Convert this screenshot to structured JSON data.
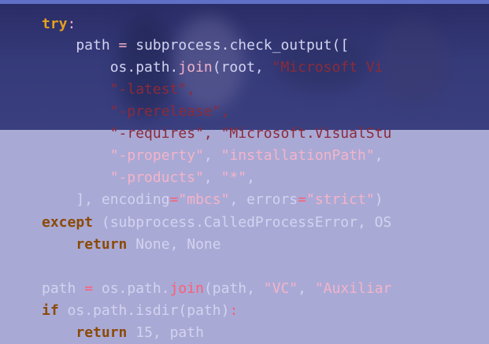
{
  "code": {
    "lines": [
      {
        "parts": [
          {
            "t": "try",
            "c": "kw"
          },
          {
            "t": ":",
            "c": "op"
          }
        ]
      },
      {
        "parts": [
          {
            "t": "    path ",
            "c": "plain"
          },
          {
            "t": "= ",
            "c": "op"
          },
          {
            "t": "subprocess.check_output([",
            "c": "plain"
          }
        ]
      },
      {
        "parts": [
          {
            "t": "        os.path.",
            "c": "plain"
          },
          {
            "t": "join",
            "c": "op"
          },
          {
            "t": "(root, ",
            "c": "plain"
          },
          {
            "t": "\"Microsoft Vi",
            "c": "str-upper"
          }
        ]
      },
      {
        "parts": [
          {
            "t": "        ",
            "c": "plain"
          },
          {
            "t": "\"-latest\",",
            "c": "str-upper"
          }
        ]
      },
      {
        "parts": [
          {
            "t": "        ",
            "c": "plain"
          },
          {
            "t": "\"-prerelease\",",
            "c": "str-upper"
          }
        ]
      },
      {
        "parts": [
          {
            "t": "        ",
            "c": "plain"
          },
          {
            "t": "\"-requires\", \"Microsoft.VisualStu",
            "c": "str-upper"
          }
        ]
      },
      {
        "parts": [
          {
            "t": "        ",
            "c": "plain"
          },
          {
            "t": "\"-property\"",
            "c": "str-lower"
          },
          {
            "t": ", ",
            "c": "plain"
          },
          {
            "t": "\"installationPath\"",
            "c": "str-lower"
          },
          {
            "t": ",",
            "c": "plain"
          }
        ]
      },
      {
        "parts": [
          {
            "t": "        ",
            "c": "plain"
          },
          {
            "t": "\"-products\"",
            "c": "str-lower"
          },
          {
            "t": ", ",
            "c": "plain"
          },
          {
            "t": "\"*\"",
            "c": "str-lower"
          },
          {
            "t": ",",
            "c": "plain"
          }
        ]
      },
      {
        "parts": [
          {
            "t": "    ], encoding",
            "c": "plain"
          },
          {
            "t": "=",
            "c": "op"
          },
          {
            "t": "\"mbcs\"",
            "c": "str-lower"
          },
          {
            "t": ", errors",
            "c": "plain"
          },
          {
            "t": "=",
            "c": "op"
          },
          {
            "t": "\"strict\"",
            "c": "str-lower"
          },
          {
            "t": ")",
            "c": "plain"
          }
        ]
      },
      {
        "parts": [
          {
            "t": "except",
            "c": "kw2"
          },
          {
            "t": " (subprocess.CalledProcessError, OS",
            "c": "plain"
          }
        ]
      },
      {
        "parts": [
          {
            "t": "    ",
            "c": "plain"
          },
          {
            "t": "return",
            "c": "kw2"
          },
          {
            "t": " None, None",
            "c": "plain"
          }
        ]
      },
      {
        "parts": [
          {
            "t": "",
            "c": "plain"
          }
        ]
      },
      {
        "parts": [
          {
            "t": "path ",
            "c": "plain"
          },
          {
            "t": "=",
            "c": "op"
          },
          {
            "t": " os.path.",
            "c": "plain"
          },
          {
            "t": "join",
            "c": "op"
          },
          {
            "t": "(path, ",
            "c": "plain"
          },
          {
            "t": "\"VC\"",
            "c": "str-lower"
          },
          {
            "t": ", ",
            "c": "plain"
          },
          {
            "t": "\"Auxiliar",
            "c": "str-lower"
          }
        ]
      },
      {
        "parts": [
          {
            "t": "if",
            "c": "kw2"
          },
          {
            "t": " os.path.isdir(path)",
            "c": "plain"
          },
          {
            "t": ":",
            "c": "op"
          }
        ]
      },
      {
        "parts": [
          {
            "t": "    ",
            "c": "plain"
          },
          {
            "t": "return",
            "c": "kw2"
          },
          {
            "t": " 15, path",
            "c": "plain"
          }
        ]
      }
    ]
  }
}
